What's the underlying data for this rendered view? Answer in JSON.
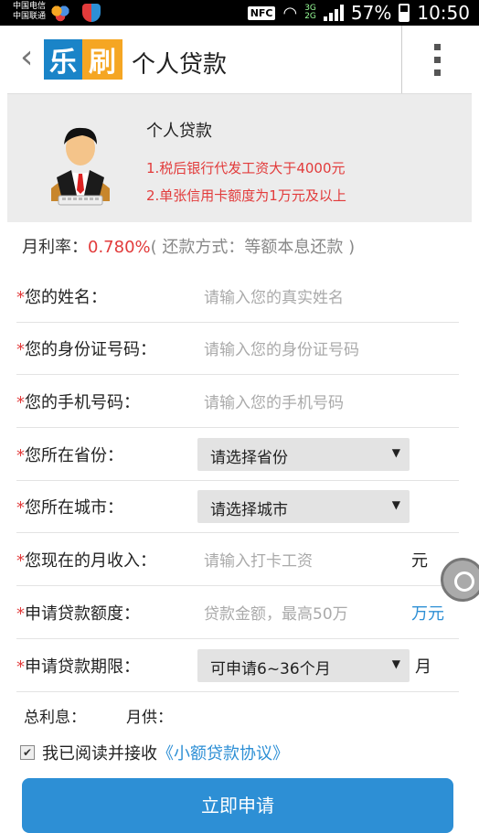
{
  "status_bar": {
    "carrier1": "中国电信",
    "carrier2": "中国联通",
    "nfc": "NFC",
    "network1": "3G",
    "network2": "2G",
    "battery": "57%",
    "time": "10:50"
  },
  "header": {
    "logo_char1": "乐",
    "logo_char2": "刷",
    "title": "个人贷款"
  },
  "banner": {
    "title": "个人贷款",
    "line1": "1.税后银行代发工资大于4000元",
    "line2": "2.单张信用卡额度为1万元及以上"
  },
  "rate": {
    "label": "月利率：",
    "value": "0.780%",
    "note": "( 还款方式：等额本息还款 )"
  },
  "form": {
    "name": {
      "label": "您的姓名：",
      "placeholder": "请输入您的真实姓名"
    },
    "id": {
      "label": "您的身份证号码：",
      "placeholder": "请输入您的身份证号码"
    },
    "phone": {
      "label": "您的手机号码：",
      "placeholder": "请输入您的手机号码"
    },
    "province": {
      "label": "您所在省份：",
      "value": "请选择省份"
    },
    "city": {
      "label": "您所在城市：",
      "value": "请选择城市"
    },
    "income": {
      "label": "您现在的月收入：",
      "placeholder": "请输入打卡工资",
      "unit": "元"
    },
    "amount": {
      "label": "申请贷款额度：",
      "placeholder": "贷款金额，最高50万",
      "unit": "万元"
    },
    "term": {
      "label": "申请贷款期限：",
      "value": "可申请6~36个月",
      "unit": "月"
    }
  },
  "totals": {
    "interest_label": "总利息：",
    "monthly_label": "月供："
  },
  "agreement": {
    "text": "我已阅读并接收",
    "link": "《小额贷款协议》"
  },
  "submit": {
    "label": "立即申请"
  },
  "colors": {
    "accent": "#2d8fd5",
    "required": "#e23b3b"
  }
}
